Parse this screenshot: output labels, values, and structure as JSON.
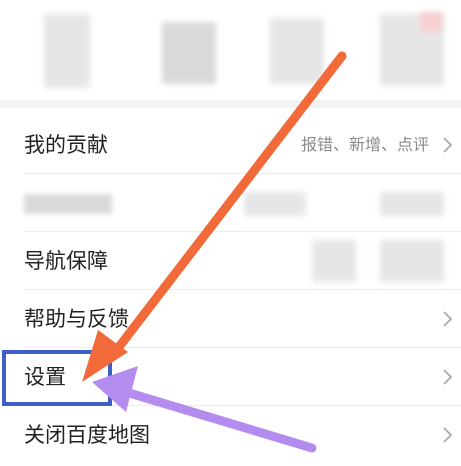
{
  "menu": {
    "contribution": {
      "label": "我的贡献",
      "detail": "报错、新增、点评"
    },
    "navigation": {
      "label": "导航保障"
    },
    "help": {
      "label": "帮助与反馈"
    },
    "settings": {
      "label": "设置"
    },
    "close_app": {
      "label": "关闭百度地图"
    }
  },
  "colors": {
    "highlight": "#3e5fc8",
    "arrow_orange": "#f2693a",
    "arrow_purple": "#b48cf0"
  }
}
